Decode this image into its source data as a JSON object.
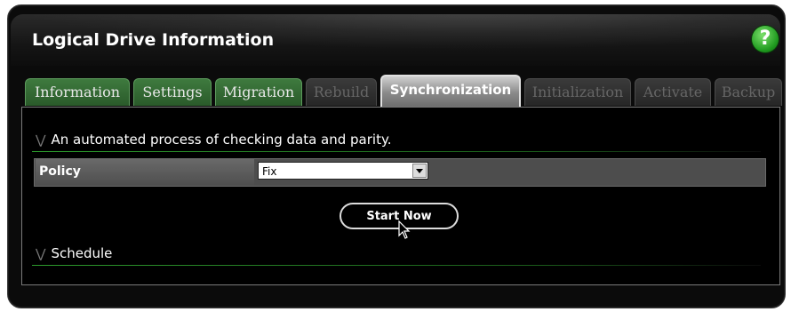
{
  "window": {
    "title": "Logical Drive Information",
    "help_label": "?"
  },
  "tabs": [
    {
      "label": "Information",
      "state": "enabled"
    },
    {
      "label": "Settings",
      "state": "enabled"
    },
    {
      "label": "Migration",
      "state": "enabled"
    },
    {
      "label": "Rebuild",
      "state": "disabled"
    },
    {
      "label": "Synchronization",
      "state": "active"
    },
    {
      "label": "Initialization",
      "state": "disabled"
    },
    {
      "label": "Activate",
      "state": "disabled"
    },
    {
      "label": "Backup",
      "state": "disabled"
    }
  ],
  "panel": {
    "description": "An automated process of checking data and parity.",
    "policy_label": "Policy",
    "policy_value": "Fix",
    "start_button": "Start Now",
    "schedule_label": "Schedule"
  },
  "colors": {
    "tab_enabled": "#3e7a3e",
    "tab_active": "#8a8a8a",
    "accent_line": "#2c9a2c",
    "help_icon": "#1f9a1f"
  }
}
